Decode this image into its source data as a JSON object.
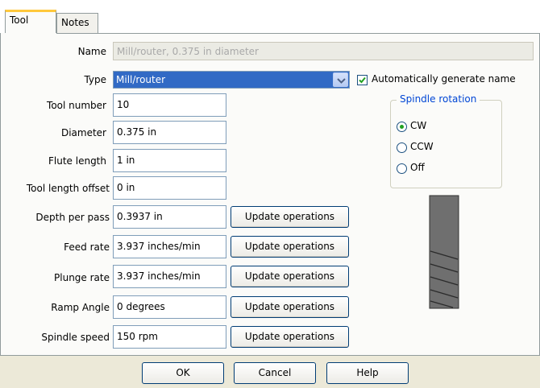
{
  "tabs": [
    {
      "label": "Tool",
      "active": true
    },
    {
      "label": "Notes",
      "active": false
    }
  ],
  "form": {
    "name_label": "Name",
    "name_value": "Mill/router, 0.375 in diameter",
    "type_label": "Type",
    "type_value": "Mill/router",
    "auto_generate_label": "Automatically generate name",
    "auto_generate_checked": true,
    "tool_number_label": "Tool number",
    "tool_number_value": "10",
    "diameter_label": "Diameter",
    "diameter_value": "0.375 in",
    "flute_length_label": "Flute length",
    "flute_length_value": "1 in",
    "tool_length_offset_label": "Tool length offset",
    "tool_length_offset_value": "0 in",
    "depth_per_pass_label": "Depth per pass",
    "depth_per_pass_value": "0.3937 in",
    "feed_rate_label": "Feed rate",
    "feed_rate_value": "3.937 inches/min",
    "plunge_rate_label": "Plunge rate",
    "plunge_rate_value": "3.937 inches/min",
    "ramp_angle_label": "Ramp Angle",
    "ramp_angle_value": "0 degrees",
    "spindle_speed_label": "Spindle speed",
    "spindle_speed_value": "150 rpm",
    "update_label": "Update operations"
  },
  "spindle": {
    "title": "Spindle rotation",
    "options": [
      {
        "label": "CW",
        "selected": true
      },
      {
        "label": "CCW",
        "selected": false
      },
      {
        "label": "Off",
        "selected": false
      }
    ]
  },
  "buttons": {
    "ok": "OK",
    "cancel": "Cancel",
    "help": "Help"
  },
  "colors": {
    "selection": "#316ac5",
    "tab_highlight": "#ffc83c",
    "radio_dot": "#21a121",
    "group_title": "#0046d5"
  },
  "icons": {
    "dropdown": "chevron-down-icon",
    "checkbox": "checkmark-icon",
    "tool_preview": "end-mill-icon"
  }
}
